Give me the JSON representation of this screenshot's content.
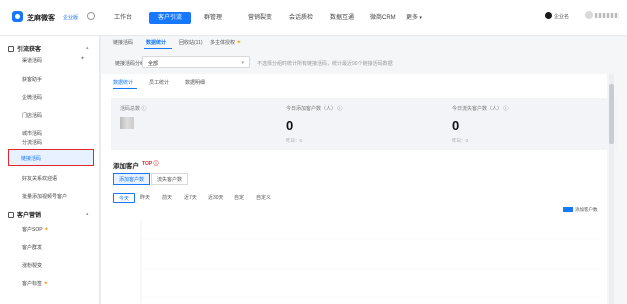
{
  "topbar": {
    "brand": "芝麻微客",
    "edition": "企业版",
    "nav": [
      "工作台",
      "客户引流",
      "群管理",
      "营销裂变",
      "会话质检",
      "数据互通",
      "微商CRM",
      "更多"
    ],
    "active_nav": "客户引流",
    "user_name": "企业名"
  },
  "sidebar": {
    "group1": "引流获客",
    "items1": [
      "渠道活码",
      "获客助手",
      "企微活码",
      "门店活码",
      "城市活码",
      "分流活码",
      "链接活码",
      "好友关系欢迎语",
      "批量添加视频号客户"
    ],
    "active_item": "链接活码",
    "group2": "客户营销",
    "items2": [
      "客户SOP",
      "客户群发",
      "涨粉裂变",
      "客户标签"
    ]
  },
  "content": {
    "tabs": [
      "链接活码",
      "数据统计",
      "回收站(11)",
      "多主体授权"
    ],
    "filter_label": "链接活码分组:",
    "filter_value": "全部",
    "filter_caret": "▾",
    "filter_hint": "不选择分组时统计所有链接活码，统计最近90个链接活码数据",
    "subtabs": [
      "数据统计",
      "员工统计",
      "数据明细"
    ],
    "cards": [
      {
        "title": "活码总数",
        "value": "",
        "foot": ""
      },
      {
        "title": "今日添加客户数（人）",
        "value": "0",
        "foot": "昨日：0"
      },
      {
        "title": "今日流失客户数（人）",
        "value": "0",
        "foot": "昨日：0"
      }
    ],
    "section_title": "添加客户",
    "section_badge": "TOP ⓘ",
    "segments": [
      "添加客户数",
      "流失客户数"
    ],
    "ranges": [
      "今天",
      "昨天",
      "前天",
      "近7天",
      "近30天",
      "自定",
      "自定义"
    ],
    "legend": "添加客户数"
  },
  "chart_data": {
    "type": "line",
    "series": [
      {
        "name": "添加客户数",
        "values": []
      }
    ],
    "grid": true,
    "legend_position": "top-right"
  },
  "colors": {
    "accent": "#1677ff",
    "highlight_border": "#e0282e"
  }
}
